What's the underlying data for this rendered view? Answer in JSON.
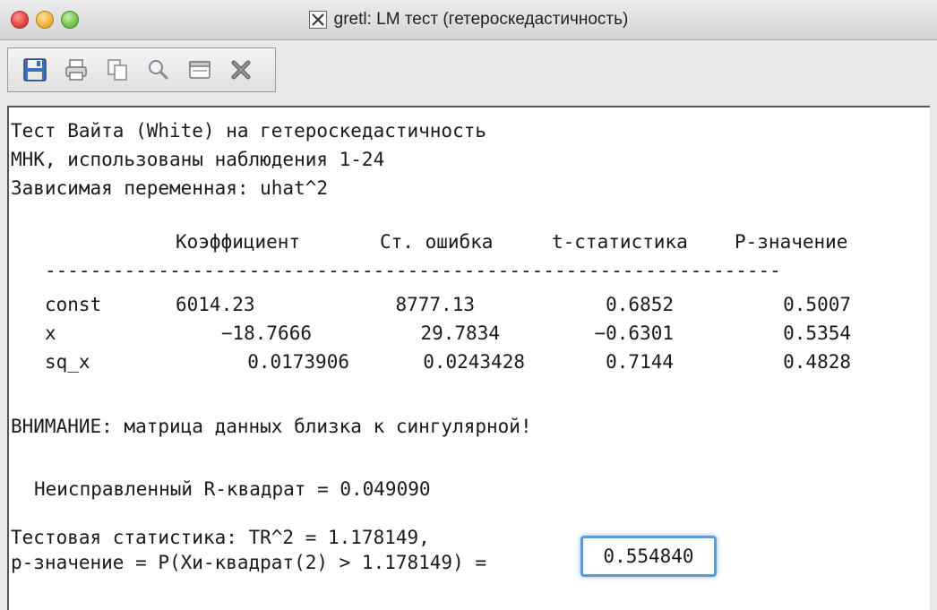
{
  "window": {
    "title": "gretl: LM тест (гетероскедастичность)"
  },
  "toolbar": {
    "buttons": [
      {
        "name": "save-icon"
      },
      {
        "name": "print-icon"
      },
      {
        "name": "copy-icon"
      },
      {
        "name": "zoom-icon"
      },
      {
        "name": "window-icon"
      },
      {
        "name": "close-icon"
      }
    ]
  },
  "output": {
    "heading1": "Тест Вайта (White) на гетероскедастичность",
    "heading2": "МНК, использованы наблюдения 1-24",
    "heading3": "Зависимая переменная: uhat^2",
    "table": {
      "columns": [
        "Коэффициент",
        "Ст. ошибка",
        "t-статистика",
        "P-значение"
      ],
      "separator": "-----------------------------------------------------------------",
      "rows": [
        {
          "var": "const",
          "coef": "6014.23",
          "se": "8777.13",
          "t": "0.6852",
          "p": "0.5007"
        },
        {
          "var": "x",
          "coef": "−18.7666",
          "se": "29.7834",
          "t": "−0.6301",
          "p": "0.5354"
        },
        {
          "var": "sq_x",
          "coef": "0.0173906",
          "se": "0.0243428",
          "t": "0.7144",
          "p": "0.4828"
        }
      ]
    },
    "warning": "ВНИМАНИЕ: матрица данных близка к сингулярной!",
    "r2": "Неисправленный R-квадрат = 0.049090",
    "stat1": "Тестовая статистика: TR^2 = 1.178149,",
    "stat2": "p-значение = P(Хи-квадрат(2) > 1.178149) =",
    "pvalue": "0.554840"
  }
}
